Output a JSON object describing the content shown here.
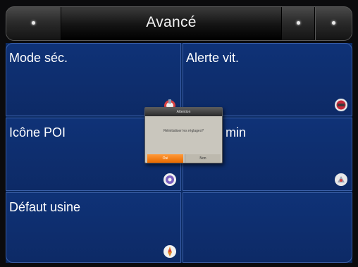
{
  "header": {
    "title": "Avancé"
  },
  "tiles": [
    {
      "label": "Mode séc.",
      "icon": "safety-mode-icon"
    },
    {
      "label": "Alerte vit.",
      "icon": "speed-alert-icon"
    },
    {
      "label": "Icône POI",
      "icon": "poi-icon"
    },
    {
      "label": "min",
      "icon": "route-icon"
    },
    {
      "label": "Défaut usine",
      "icon": "factory-reset-icon"
    },
    {
      "label": "",
      "icon": ""
    }
  ],
  "dialog": {
    "title": "Attention",
    "message": "Réinitialiser les réglages?",
    "yes_label": "Oui",
    "no_label": "Non"
  },
  "colors": {
    "tile_bg": "#0d2a66",
    "tile_border": "#3a5fa8",
    "dialog_yes": "#e86a00"
  }
}
